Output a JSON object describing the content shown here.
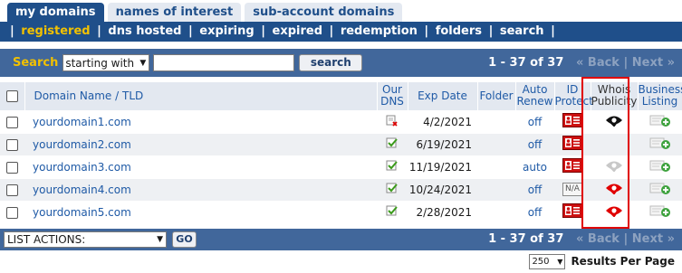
{
  "tabs": [
    {
      "label": "my domains"
    },
    {
      "label": "names of interest"
    },
    {
      "label": "sub-account domains"
    }
  ],
  "subnav": [
    {
      "label": "registered"
    },
    {
      "label": "dns hosted"
    },
    {
      "label": "expiring"
    },
    {
      "label": "expired"
    },
    {
      "label": "redemption"
    },
    {
      "label": "folders"
    },
    {
      "label": "search"
    }
  ],
  "search": {
    "label": "Search",
    "mode": "starting with",
    "value": "",
    "button": "search"
  },
  "pager": {
    "range": "1 - 37 of 37",
    "back": "Back",
    "next": "Next"
  },
  "columns": {
    "domain": "Domain Name",
    "slash": "/",
    "tld": "TLD",
    "our_dns_1": "Our",
    "our_dns_2": "DNS",
    "exp_date": "Exp Date",
    "folder": "Folder",
    "auto_renew_1": "Auto",
    "auto_renew_2": "Renew",
    "id_protect_1": "ID",
    "id_protect_2": "Protect",
    "whois_1": "Whois",
    "whois_2": "Publicity",
    "business_1": "Business",
    "business_2": "Listing"
  },
  "rows": [
    {
      "domain": "yourdomain1.com",
      "dns": "dns-error-icon",
      "exp": "4/2/2021",
      "auto": "off",
      "id": "id-protect-icon",
      "whois": "eye-black-icon"
    },
    {
      "domain": "yourdomain2.com",
      "dns": "dns-ok-icon",
      "exp": "6/19/2021",
      "auto": "off",
      "id": "id-protect-icon",
      "whois": ""
    },
    {
      "domain": "yourdomain3.com",
      "dns": "dns-ok-icon",
      "exp": "11/19/2021",
      "auto": "auto",
      "id": "id-protect-icon",
      "whois": "eye-gray-icon"
    },
    {
      "domain": "yourdomain4.com",
      "dns": "dns-ok-icon",
      "exp": "10/24/2021",
      "auto": "off",
      "id": "na-icon",
      "whois": "eye-red-icon"
    },
    {
      "domain": "yourdomain5.com",
      "dns": "dns-ok-icon",
      "exp": "2/28/2021",
      "auto": "off",
      "id": "id-protect-icon",
      "whois": "eye-red-icon"
    }
  ],
  "na_text": "N/A",
  "footer": {
    "actions": "LIST ACTIONS:",
    "go": "GO",
    "per_page_value": "250",
    "per_page_label": "Results Per Page"
  },
  "colors": {
    "nav": "#1f4f8a",
    "bar": "#41679b",
    "accent": "#f2c100",
    "link": "#1f5aa6",
    "highlight_box": "#e00000"
  }
}
